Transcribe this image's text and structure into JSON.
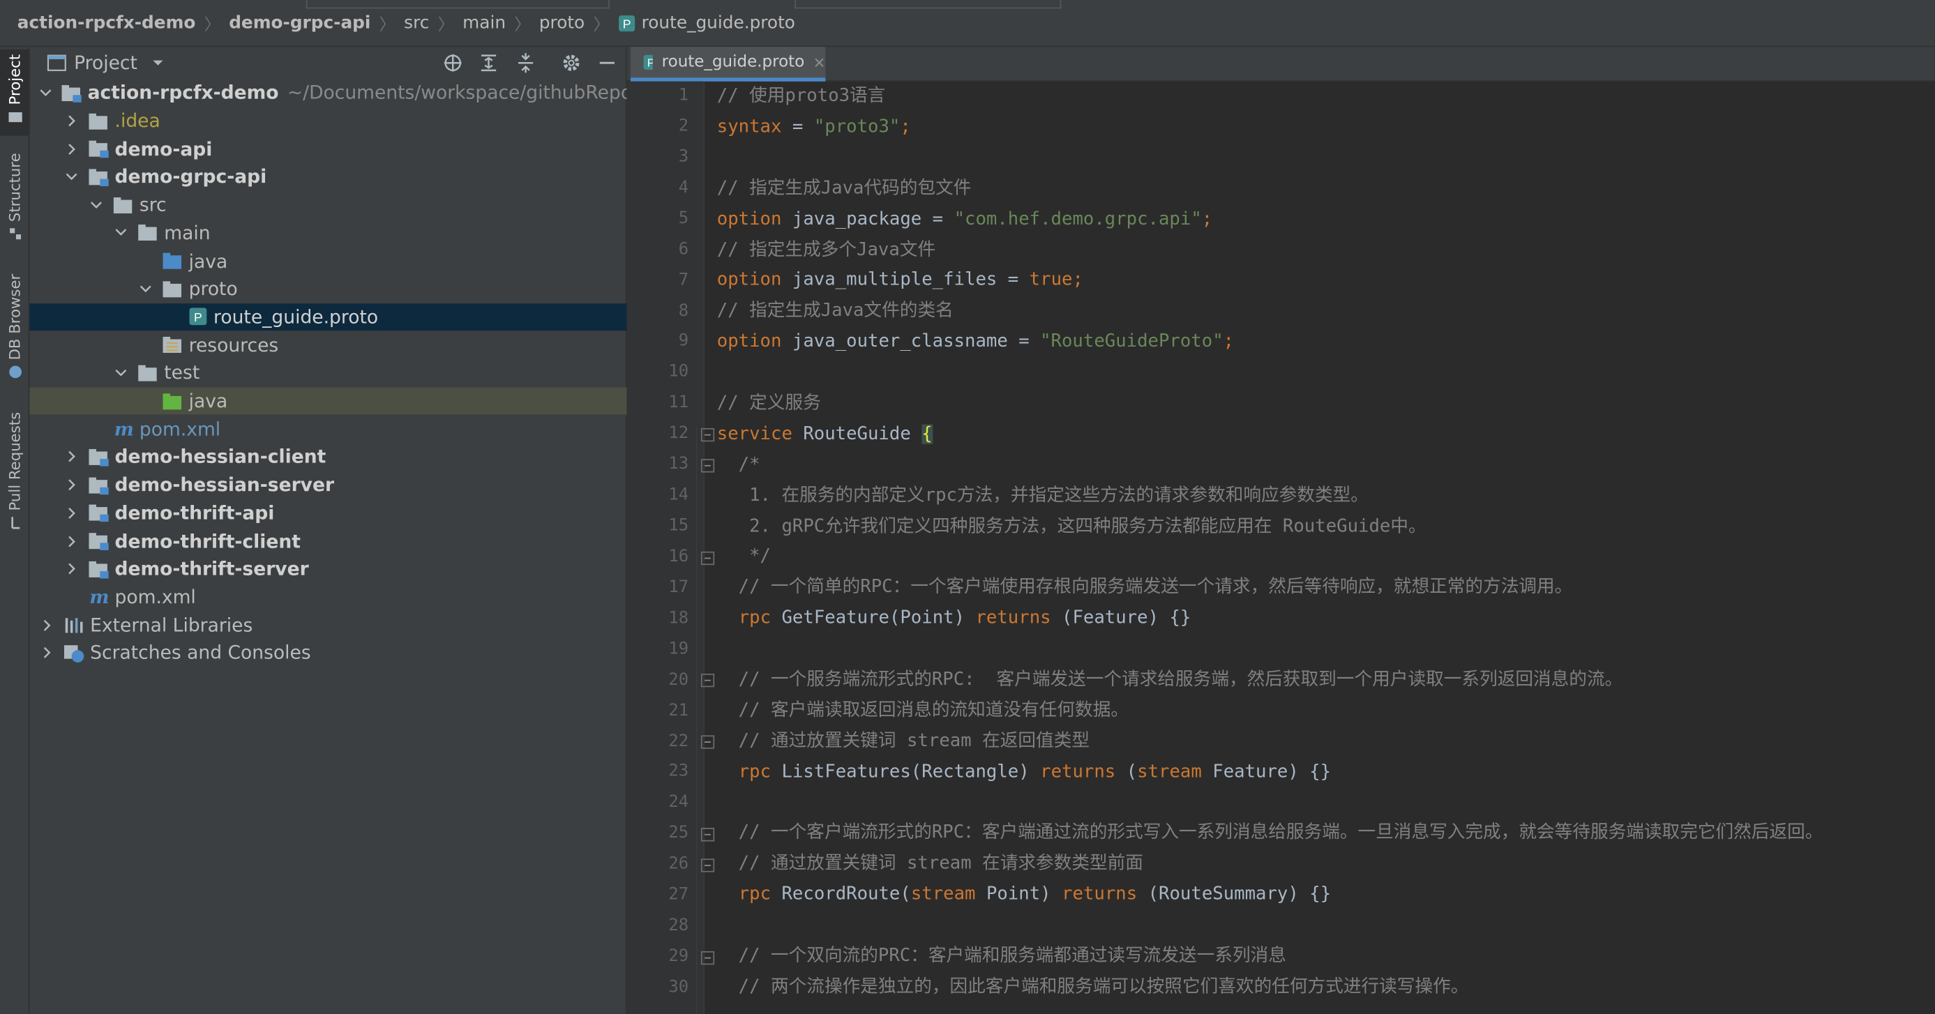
{
  "breadcrumb": {
    "project": "action-rpcfx-demo",
    "module": "demo-grpc-api",
    "dir1": "src",
    "dir2": "main",
    "dir3": "proto",
    "file": "route_guide.proto",
    "file_icon": "P"
  },
  "stripe": {
    "project": "Project",
    "structure": "Structure",
    "db_browser": "DB Browser",
    "pull_requests": "Pull Requests"
  },
  "project_panel": {
    "title": "Project",
    "tree": [
      {
        "name": "action-rpcfx-demo",
        "path": "~/Documents/workspace/githubReposito"
      },
      {
        "name": ".idea"
      },
      {
        "name": "demo-api"
      },
      {
        "name": "demo-grpc-api"
      },
      {
        "name": "src"
      },
      {
        "name": "main"
      },
      {
        "name": "java"
      },
      {
        "name": "proto"
      },
      {
        "name": "route_guide.proto"
      },
      {
        "name": "resources"
      },
      {
        "name": "test"
      },
      {
        "name": "java"
      },
      {
        "name": "pom.xml"
      },
      {
        "name": "demo-hessian-client"
      },
      {
        "name": "demo-hessian-server"
      },
      {
        "name": "demo-thrift-api"
      },
      {
        "name": "demo-thrift-client"
      },
      {
        "name": "demo-thrift-server"
      },
      {
        "name": "pom.xml"
      },
      {
        "name": "External Libraries"
      },
      {
        "name": "Scratches and Consoles"
      }
    ]
  },
  "editor": {
    "tab_label": "route_guide.proto",
    "tab_icon": "P",
    "line_numbers": [
      "1",
      "2",
      "3",
      "4",
      "5",
      "6",
      "7",
      "8",
      "9",
      "10",
      "11",
      "12",
      "13",
      "14",
      "15",
      "16",
      "17",
      "18",
      "19",
      "20",
      "21",
      "22",
      "23",
      "24",
      "25",
      "26",
      "27",
      "28",
      "29",
      "30"
    ],
    "code": {
      "l1": "// 使用proto3语言",
      "l2_kw": "syntax",
      "l2_eq": " = ",
      "l2_str": "\"proto3\"",
      "l2_end": ";",
      "l4": "// 指定生成Java代码的包文件",
      "l5_kw": "option",
      "l5_id": " java_package = ",
      "l5_str": "\"com.hef.demo.grpc.api\"",
      "l5_end": ";",
      "l6": "// 指定生成多个Java文件",
      "l7_kw": "option",
      "l7_id": " java_multiple_files = ",
      "l7_val": "true",
      "l7_end": ";",
      "l8": "// 指定生成Java文件的类名",
      "l9_kw": "option",
      "l9_id": " java_outer_classname = ",
      "l9_str": "\"RouteGuideProto\"",
      "l9_end": ";",
      "l11": "// 定义服务",
      "l12_kw": "service",
      "l12_id": " RouteGuide ",
      "l12_brace": "{",
      "l13": "  /*",
      "l14": "   1. 在服务的内部定义rpc方法，并指定这些方法的请求参数和响应参数类型。",
      "l15": "   2. gRPC允许我们定义四种服务方法，这四种服务方法都能应用在 RouteGuide中。",
      "l16": "   */",
      "l17": "  // 一个简单的RPC：一个客户端使用存根向服务端发送一个请求，然后等待响应，就想正常的方法调用。",
      "l18_pre": "  ",
      "l18_kw": "rpc",
      "l18_a": " GetFeature(Point) ",
      "l18_kw2": "returns",
      "l18_b": " (Feature) {}",
      "l20": "  // 一个服务端流形式的RPC:  客户端发送一个请求给服务端，然后获取到一个用户读取一系列返回消息的流。",
      "l21": "  // 客户端读取返回消息的流知道没有任何数据。",
      "l22": "  // 通过放置关键词 stream 在返回值类型",
      "l23_pre": "  ",
      "l23_kw": "rpc",
      "l23_a": " ListFeatures(Rectangle) ",
      "l23_kw2": "returns",
      "l23_b": " (",
      "l23_kw3": "stream",
      "l23_c": " Feature) {}",
      "l25": "  // 一个客户端流形式的RPC：客户端通过流的形式写入一系列消息给服务端。一旦消息写入完成，就会等待服务端读取完它们然后返回。",
      "l26": "  // 通过放置关键词 stream 在请求参数类型前面",
      "l27_pre": "  ",
      "l27_kw": "rpc",
      "l27_a": " RecordRoute(",
      "l27_kw2": "stream",
      "l27_b": " Point) ",
      "l27_kw3": "returns",
      "l27_c": " (RouteSummary) {}",
      "l29": "  // 一个双向流的PRC：客户端和服务端都通过读写流发送一系列消息",
      "l30": "  // 两个流操作是独立的，因此客户端和服务端可以按照它们喜欢的任何方式进行读写操作。"
    }
  },
  "colors": {
    "background": "#2b2b2b",
    "panel": "#3c3f41",
    "selection": "#0d293e",
    "keyword": "#cc7832",
    "string": "#6a8759",
    "comment": "#808080",
    "accent": "#4a88c7"
  },
  "icons": {
    "project_view": "project-view-icon",
    "dropdown": "chevron-down-icon",
    "locate": "crosshair-icon",
    "expand_all": "expand-all-icon",
    "collapse_all": "collapse-all-icon",
    "settings": "gear-icon",
    "hide": "minimize-icon"
  }
}
